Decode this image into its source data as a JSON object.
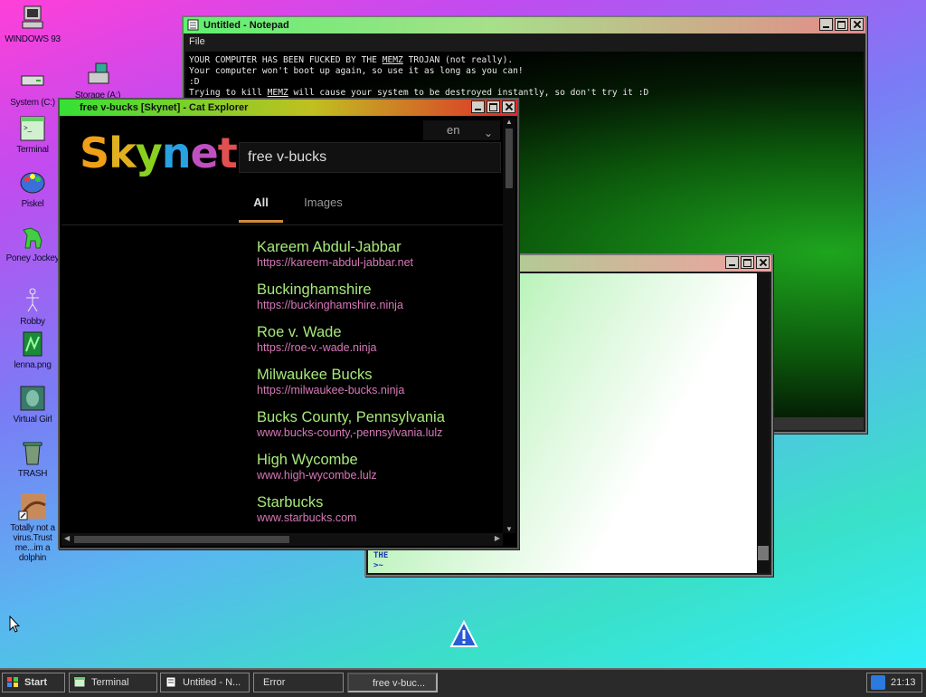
{
  "desktop": {
    "icons": [
      {
        "label": "WINDOWS 93"
      },
      {
        "label": "System (C:)"
      },
      {
        "label": "Storage (A:)"
      },
      {
        "label": "Terminal"
      },
      {
        "label": "Piskel"
      },
      {
        "label": "Poney Jockey"
      },
      {
        "label": "Robby"
      },
      {
        "label": "lenna.png"
      },
      {
        "label": "Virtual Girl"
      },
      {
        "label": "TRASH"
      },
      {
        "label": "Totally not a virus.Trust me...im a dolphin"
      }
    ]
  },
  "notepad": {
    "title": "Untitled - Notepad",
    "menu_file": "File",
    "line1_pre": "YOUR COMPUTER HAS BEEN FUCKED BY THE ",
    "line1_u": "MEMZ",
    "line1_post": " TROJAN (not really).",
    "line2": "Your computer won't boot up again, so use it as long as you can!",
    "line3": ":D",
    "line4_pre": "Trying to kill ",
    "line4_u": "MEMZ",
    "line4_post": " will cause your system to be destroyed instantly, so don't try it :D"
  },
  "terminal": {
    "line1": "THE",
    "prompt": ">~"
  },
  "explorer": {
    "title": "free v-bucks [Skynet] - Cat Explorer",
    "logo": "Skynet",
    "lang": "en",
    "search_value": "free v-bucks",
    "tabs": [
      {
        "label": "All"
      },
      {
        "label": "Images"
      }
    ],
    "results": [
      {
        "title": "Kareem Abdul-Jabbar",
        "url": "https://kareem-abdul-jabbar.net"
      },
      {
        "title": "Buckinghamshire",
        "url": "https://buckinghamshire.ninja"
      },
      {
        "title": "Roe v. Wade",
        "url": "https://roe-v.-wade.ninja"
      },
      {
        "title": "Milwaukee Bucks",
        "url": "https://milwaukee-bucks.ninja"
      },
      {
        "title": "Bucks County, Pennsylvania",
        "url": "www.bucks-county,-pennsylvania.lulz"
      },
      {
        "title": "High Wycombe",
        "url": "www.high-wycombe.lulz"
      },
      {
        "title": "Starbucks",
        "url": "www.starbucks.com"
      }
    ]
  },
  "taskbar": {
    "start": "Start",
    "items": [
      {
        "label": "Terminal"
      },
      {
        "label": "Untitled - N..."
      },
      {
        "label": "Error"
      },
      {
        "label": "free v-buc..."
      }
    ],
    "clock": "21:13"
  },
  "colors": {
    "result_title": "#a8e87a",
    "result_url": "#d879b8",
    "tab_underline": "#d08a3a"
  }
}
